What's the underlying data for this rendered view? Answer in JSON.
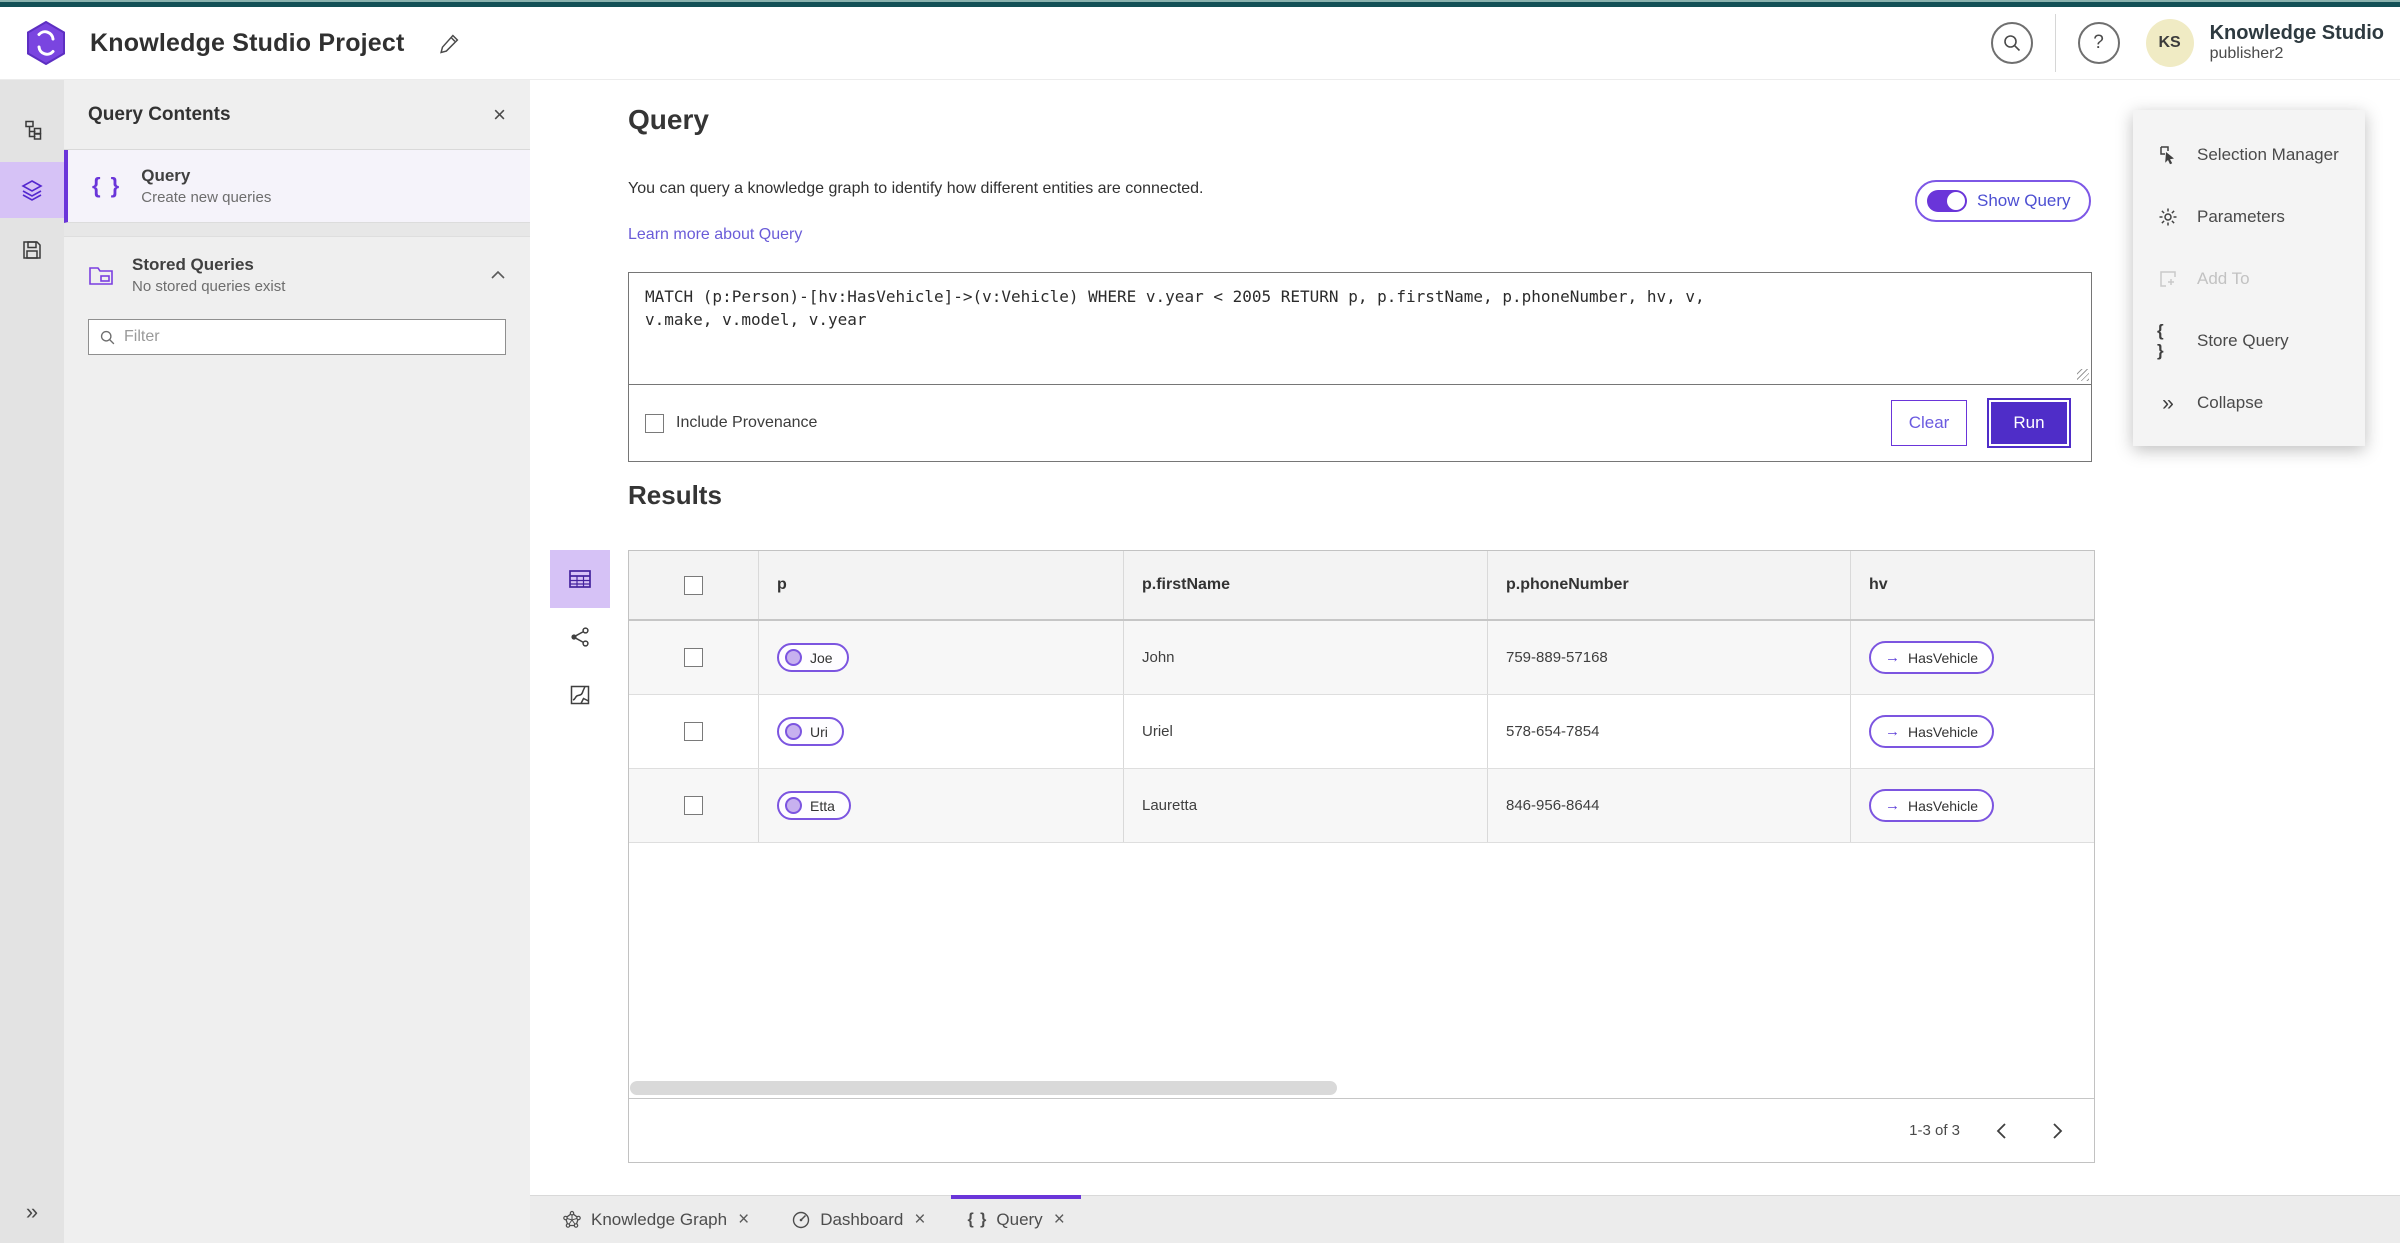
{
  "header": {
    "title": "Knowledge Studio Project",
    "user_name": "Knowledge Studio",
    "user_role": "publisher2",
    "avatar_initials": "KS",
    "help_label": "?"
  },
  "panel": {
    "title": "Query Contents",
    "query_item": {
      "title": "Query",
      "subtitle": "Create new queries"
    },
    "stored": {
      "title": "Stored Queries",
      "subtitle": "No stored queries exist"
    },
    "filter_placeholder": "Filter"
  },
  "query_section": {
    "heading": "Query",
    "description": "You can query a knowledge graph to identify how different entities are connected.",
    "learn_more": "Learn more about Query",
    "show_query_label": "Show Query",
    "query_text": "MATCH (p:Person)-[hv:HasVehicle]->(v:Vehicle) WHERE v.year < 2005 RETURN p, p.firstName, p.phoneNumber, hv, v,\nv.make, v.model, v.year",
    "include_provenance": "Include Provenance",
    "clear_label": "Clear",
    "run_label": "Run"
  },
  "results": {
    "heading": "Results",
    "columns": [
      "p",
      "p.firstName",
      "p.phoneNumber",
      "hv"
    ],
    "rows": [
      {
        "p": "Joe",
        "firstName": "John",
        "phone": "759-889-57168",
        "hv": "HasVehicle"
      },
      {
        "p": "Uri",
        "firstName": "Uriel",
        "phone": "578-654-7854",
        "hv": "HasVehicle"
      },
      {
        "p": "Etta",
        "firstName": "Lauretta",
        "phone": "846-956-8644",
        "hv": "HasVehicle"
      }
    ],
    "pagination": "1-3 of 3"
  },
  "right_panel": {
    "items": [
      {
        "label": "Selection Manager"
      },
      {
        "label": "Parameters"
      },
      {
        "label": "Add To"
      },
      {
        "label": "Store Query"
      },
      {
        "label": "Collapse"
      }
    ]
  },
  "tabs": [
    {
      "label": "Knowledge Graph"
    },
    {
      "label": "Dashboard"
    },
    {
      "label": "Query"
    }
  ],
  "icons": {
    "braces": "{ }",
    "collapse": "»",
    "close": "×",
    "arrow_right": "→",
    "expand": "»"
  },
  "colors": {
    "accent_purple": "#6a35d9",
    "run_purple": "#4f2dc8",
    "top_teal": "#135056",
    "selected_bg": "#d6c2f6"
  }
}
